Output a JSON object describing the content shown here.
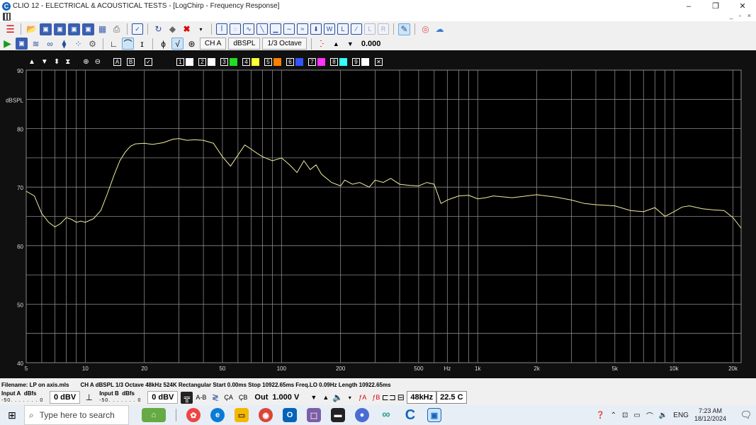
{
  "window": {
    "title": "CLIO 12 - ELECTRICAL & ACOUSTICAL TESTS - [LogChirp - Frequency Response]",
    "app_icon_letter": "C",
    "minimize": "–",
    "restore": "❐",
    "close": "✕",
    "mdi_controls": "_ ▫ ×"
  },
  "toolbar2": {
    "channel": "CH A",
    "unit": "dBSPL",
    "smoothing": "1/3 Octave",
    "offset_value": "0.000"
  },
  "graph_toolbar": {
    "btn_a": "A",
    "btn_b": "B",
    "overlays": [
      {
        "num": "1",
        "color": "#ffffff"
      },
      {
        "num": "2",
        "color": "#ffffff"
      },
      {
        "num": "3",
        "color": "#22dd22"
      },
      {
        "num": "4",
        "color": "#ffff33"
      },
      {
        "num": "5",
        "color": "#ff7f00"
      },
      {
        "num": "6",
        "color": "#3355ff"
      },
      {
        "num": "7",
        "color": "#ff33ff"
      },
      {
        "num": "8",
        "color": "#33ffff"
      },
      {
        "num": "9",
        "color": "#ffffff"
      }
    ],
    "close_box": "✕"
  },
  "chart_data": {
    "type": "line",
    "ylabel": "dBSPL",
    "xlabel": "Hz",
    "xscale": "log",
    "xlim": [
      5,
      22000
    ],
    "ylim": [
      40,
      90
    ],
    "y_ticks": [
      90,
      80,
      70,
      60,
      50,
      40
    ],
    "x_ticks": [
      {
        "v": 5,
        "label": "5"
      },
      {
        "v": 10,
        "label": "10"
      },
      {
        "v": 20,
        "label": "20"
      },
      {
        "v": 50,
        "label": "50"
      },
      {
        "v": 100,
        "label": "100"
      },
      {
        "v": 200,
        "label": "200"
      },
      {
        "v": 500,
        "label": "500"
      },
      {
        "v": 1000,
        "label": "1k"
      },
      {
        "v": 2000,
        "label": "2k"
      },
      {
        "v": 5000,
        "label": "5k"
      },
      {
        "v": 10000,
        "label": "10k"
      },
      {
        "v": 20000,
        "label": "20k"
      }
    ],
    "grid": true,
    "line_color": "#f2eea0",
    "background": "#000000",
    "series": [
      {
        "x": [
          5,
          5.5,
          6,
          6.5,
          7,
          7.5,
          8,
          8.5,
          9,
          9.5,
          10,
          11,
          12,
          13,
          14,
          15,
          16,
          17,
          18,
          20,
          22,
          25,
          28,
          30,
          33,
          36,
          40,
          45,
          50,
          55,
          60,
          65,
          70,
          75,
          80,
          90,
          100,
          110,
          120,
          130,
          140,
          150,
          160,
          180,
          200,
          210,
          230,
          250,
          280,
          300,
          330,
          360,
          400,
          450,
          500,
          550,
          600,
          650,
          700,
          800,
          900,
          1000,
          1100,
          1200,
          1500,
          2000,
          2500,
          3000,
          3500,
          4000,
          5000,
          6000,
          7000,
          8000,
          9000,
          10000,
          11000,
          12000,
          14000,
          16000,
          18000,
          20000,
          22000
        ],
        "y": [
          69.3,
          68.5,
          65.5,
          64.0,
          63.2,
          63.8,
          64.8,
          64.5,
          64.0,
          64.2,
          64.0,
          64.6,
          66.0,
          69.0,
          72.0,
          74.5,
          76.0,
          77.0,
          77.4,
          77.5,
          77.3,
          77.6,
          78.2,
          78.3,
          78.0,
          78.1,
          78.0,
          77.5,
          75.2,
          73.6,
          75.5,
          77.2,
          76.5,
          75.8,
          75.2,
          74.5,
          75.0,
          73.8,
          72.5,
          74.5,
          73.0,
          73.8,
          72.2,
          70.8,
          70.2,
          71.2,
          70.5,
          70.8,
          70.0,
          71.2,
          70.8,
          71.5,
          70.5,
          70.3,
          70.2,
          70.8,
          70.5,
          67.2,
          67.8,
          68.5,
          68.6,
          68.0,
          68.2,
          68.5,
          68.2,
          68.7,
          68.3,
          67.8,
          67.2,
          67.0,
          66.8,
          66.0,
          65.8,
          66.5,
          65.0,
          65.8,
          66.6,
          66.8,
          66.3,
          66.1,
          66.0,
          64.8,
          63.0
        ]
      }
    ]
  },
  "status": {
    "filename": "Filename: LP on axis.mls",
    "meas_info": "CH A  dBSPL  1/3 Octave  48kHz  524K  Rectangular  Start 0.00ms  Stop 10922.65ms  Freq.LO 0.09Hz  Length 10922.65ms",
    "input_a": "Input A",
    "input_b": "Input B",
    "dbfs": "dBfs",
    "meter_scale": "-50.  .  .  .  .  .  .  0",
    "in_a_value": "0 dBV",
    "in_b_value": "0 dBV",
    "ab": "A-B",
    "ca": "ÇA",
    "cb": "ÇB",
    "out_label": "Out",
    "out_value": "1.000 V",
    "gen_a": "ƒA",
    "gen_b": "ƒB",
    "sample_rate": "48kHz",
    "temperature": "22.5 C"
  },
  "taskbar": {
    "search_placeholder": "Type here to search",
    "lang": "ENG",
    "time": "7:23 AM",
    "date": "18/12/2024"
  }
}
